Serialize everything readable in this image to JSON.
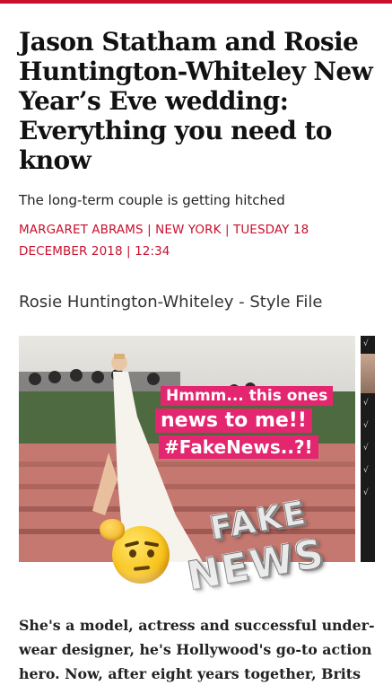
{
  "article": {
    "headline": "Jason Statham and Rosie Huntington-Whiteley New Year’s Eve wedding: Everything you need to know",
    "subheadline": "The long-term couple is getting hitched",
    "byline": "MARGARET ABRAMS | NEW YORK | TUESDAY 18 DECEMBER 2018 | 12:34",
    "gallery_title": "Rosie Huntington-Whiteley - Style File",
    "body": "She's a model, actress and successful under-wear designer, he's Hollywood's go-to action hero. Now, after eight years together, Brits"
  },
  "stickers": {
    "line1": "Hmmm... this ones",
    "line2": "news to me!!",
    "line3": "#FakeNews..?!",
    "fake_word": "FAKE",
    "news_word": "NEWS",
    "emoji": "thinking-face-icon"
  },
  "colors": {
    "accent": "#c8102e",
    "sticker_bg": "#e3266f"
  }
}
